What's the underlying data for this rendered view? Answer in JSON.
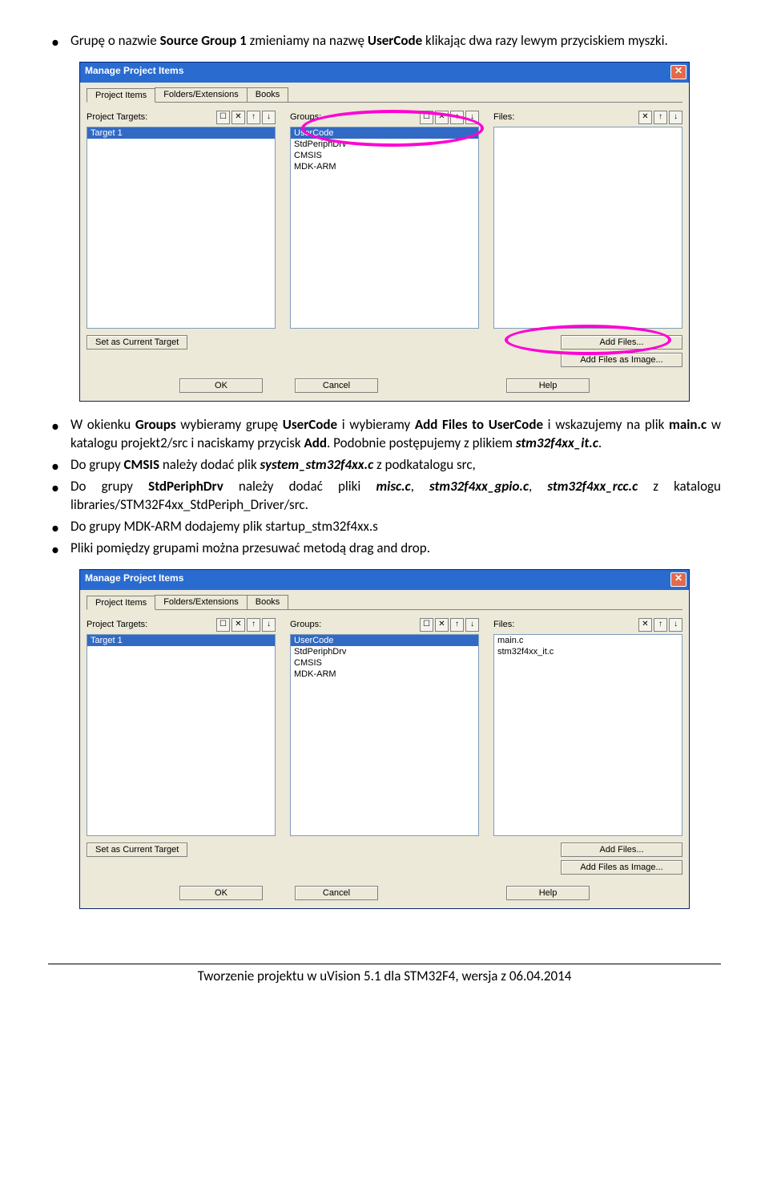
{
  "doc": {
    "bullets1": {
      "b1_p1": "Grupę o nazwie ",
      "b1_s1": "Source Group 1",
      "b1_p2": " zmieniamy na nazwę ",
      "b1_s2": "UserCode",
      "b1_p3": " klikając dwa razy lewym przyciskiem myszki."
    },
    "bullets2": {
      "b1_p1": "W okienku ",
      "b1_s1": "Groups",
      "b1_p2": " wybieramy  grupę ",
      "b1_s2": "UserCode",
      "b1_p3": "  i wybieramy ",
      "b1_s3": "Add Files to UserCode",
      "b1_p4": " i wskazujemy na plik ",
      "b1_s4": "main.c",
      "b1_p5": " w katalogu projekt2/src i naciskamy przycisk ",
      "b1_s5": "Add",
      "b1_p6": ". Podobnie postępujemy z plikiem ",
      "b1_s6": "stm32f4xx_it.c",
      "b1_p7": ".",
      "b2_p1": "Do grupy ",
      "b2_s1": "CMSIS",
      "b2_p2": " należy dodać plik ",
      "b2_s2": "system_stm32f4xx.c",
      "b2_p3": " z podkatalogu src,",
      "b3_p1": "Do grupy ",
      "b3_s1": "StdPeriphDrv",
      "b3_p2": " należy dodać pliki ",
      "b3_s2": "misc.c",
      "b3_p3": ", ",
      "b3_s3": "stm32f4xx_gpio.c",
      "b3_p4": ", ",
      "b3_s4": "stm32f4xx_rcc.c",
      "b3_p5": " z katalogu libraries/STM32F4xx_StdPeriph_Driver/src.",
      "b4": "Do grupy MDK-ARM dodajemy plik startup_stm32f4xx.s",
      "b5": "Pliki pomiędzy grupami można przesuwać  metodą drag and drop."
    },
    "footer": "Tworzenie projektu w uVision 5.1 dla STM32F4,  wersja z 06.04.2014"
  },
  "dialog": {
    "title": "Manage Project Items",
    "tabs": [
      "Project Items",
      "Folders/Extensions",
      "Books"
    ],
    "col_targets": "Project Targets:",
    "col_groups": "Groups:",
    "col_files": "Files:",
    "targets": [
      "Target 1"
    ],
    "groups": [
      "UserCode",
      "StdPeriphDrv",
      "CMSIS",
      "MDK-ARM"
    ],
    "files1": [],
    "files2": [
      "main.c",
      "stm32f4xx_it.c"
    ],
    "btn_set_current": "Set as Current Target",
    "btn_add_files": "Add Files...",
    "btn_add_image": "Add Files as Image...",
    "btn_ok": "OK",
    "btn_cancel": "Cancel",
    "btn_help": "Help",
    "tb_new": "☐",
    "tb_del": "✕",
    "tb_up": "↑",
    "tb_down": "↓"
  }
}
